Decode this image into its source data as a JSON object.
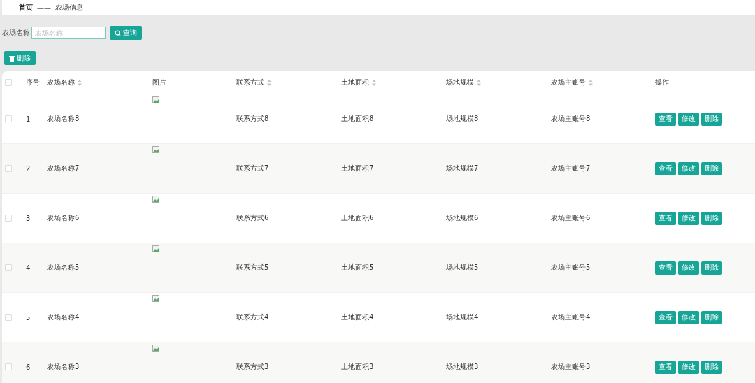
{
  "breadcrumb": {
    "items": [
      "首页",
      "农场信息"
    ],
    "separator": "——"
  },
  "search": {
    "label": "农场名称",
    "placeholder": "农场名称",
    "button": "查询"
  },
  "toolbar": {
    "delete_button": "删除"
  },
  "table": {
    "all_checked": false,
    "columns": [
      {
        "label": "序号",
        "sortable": false
      },
      {
        "label": "农场名称",
        "sortable": true
      },
      {
        "label": "图片",
        "sortable": false
      },
      {
        "label": "联系方式",
        "sortable": true
      },
      {
        "label": "土地面积",
        "sortable": true
      },
      {
        "label": "场地规模",
        "sortable": true
      },
      {
        "label": "农场主账号",
        "sortable": true
      },
      {
        "label": "操作",
        "sortable": false
      }
    ],
    "rows": [
      {
        "checked": false,
        "cells": [
          "1",
          "农场名称8",
          "",
          "联系方式8",
          "土地面积8",
          "场地规模8",
          "农场主账号8"
        ],
        "actions": [
          "查看",
          "修改",
          "删除"
        ]
      },
      {
        "checked": false,
        "cells": [
          "2",
          "农场名称7",
          "",
          "联系方式7",
          "土地面积7",
          "场地规模7",
          "农场主账号7"
        ],
        "actions": [
          "查看",
          "修改",
          "删除"
        ]
      },
      {
        "checked": false,
        "cells": [
          "3",
          "农场名称6",
          "",
          "联系方式6",
          "土地面积6",
          "场地规模6",
          "农场主账号6"
        ],
        "actions": [
          "查看",
          "修改",
          "删除"
        ]
      },
      {
        "checked": false,
        "cells": [
          "4",
          "农场名称5",
          "",
          "联系方式5",
          "土地面积5",
          "场地规模5",
          "农场主账号5"
        ],
        "actions": [
          "查看",
          "修改",
          "删除"
        ]
      },
      {
        "checked": false,
        "cells": [
          "5",
          "农场名称4",
          "",
          "联系方式4",
          "土地面积4",
          "场地规模4",
          "农场主账号4"
        ],
        "actions": [
          "查看",
          "修改",
          "删除"
        ]
      },
      {
        "checked": false,
        "cells": [
          "6",
          "农场名称3",
          "",
          "联系方式3",
          "土地面积3",
          "场地规模3",
          "农场主账号3"
        ],
        "actions": [
          "查看",
          "修改",
          "删除"
        ]
      }
    ]
  }
}
